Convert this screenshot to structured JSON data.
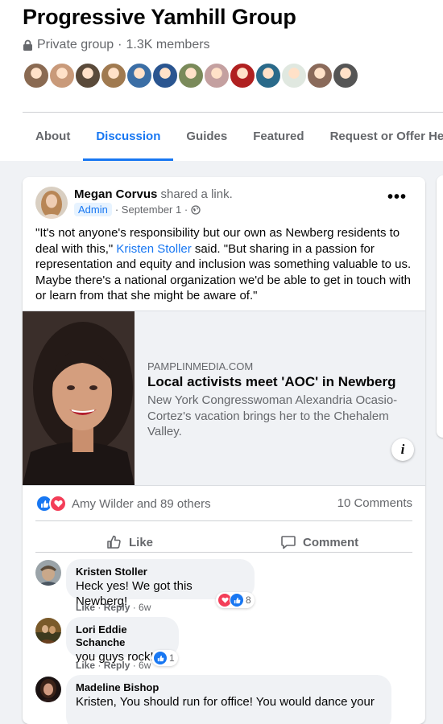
{
  "group": {
    "name": "Progressive Yamhill Group",
    "privacy": "Private group",
    "separator": "·",
    "members": "1.3K members"
  },
  "tabs": [
    {
      "label": "About"
    },
    {
      "label": "Discussion"
    },
    {
      "label": "Guides"
    },
    {
      "label": "Featured"
    },
    {
      "label": "Request or Offer Help"
    }
  ],
  "member_avatar_colors": [
    "#8a6a52",
    "#c99a7a",
    "#5a4a3a",
    "#a07a50",
    "#3b6ea5",
    "#2a5590",
    "#7a8a5a",
    "#c4a0a0",
    "#b02020",
    "#2a6a8a",
    "#e0e8e0",
    "#8a6a5a",
    "#555555"
  ],
  "post": {
    "author": "Megan Corvus",
    "action": " shared a link.",
    "badge": "Admin",
    "date": " · September 1 · ",
    "more": "•••",
    "text_part1": "\"It's not anyone's responsibility but our own as Newberg residents to deal with this,\" ",
    "text_link": "Kristen Stoller",
    "text_part2": " said. \"But sharing in a passion for representation and equity and inclusion was something valuable to us. Maybe there's a national organization we'd be able to get in touch with or learn from that she might be aware of.\"",
    "link_preview": {
      "domain": "PAMPLINMEDIA.COM",
      "title": "Local activists meet 'AOC' in Newberg",
      "description": "New York Congresswoman Alexandria Ocasio-Cortez's vacation brings her to the Chehalem Valley.",
      "info": "i"
    },
    "reactions_text": "Amy Wilder and 89 others",
    "comments_count": "10 Comments",
    "like_label": "Like",
    "comment_label": "Comment"
  },
  "comments": [
    {
      "name": "Kristen Stoller",
      "text": "Heck yes! We got this Newberg!",
      "like": "Like",
      "reply": "Reply",
      "time": "6w",
      "reaction_count": "8"
    },
    {
      "name": "Lori Eddie Schanche",
      "text": "you guys rock!",
      "like": "Like",
      "reply": "Reply",
      "time": "6w",
      "reaction_count": "1"
    },
    {
      "name": "Madeline Bishop",
      "text": "Kristen, You should run for office! You would dance your"
    }
  ],
  "colors": {
    "accent": "#1877f2",
    "love": "#f33e58",
    "muted": "#65676b"
  }
}
